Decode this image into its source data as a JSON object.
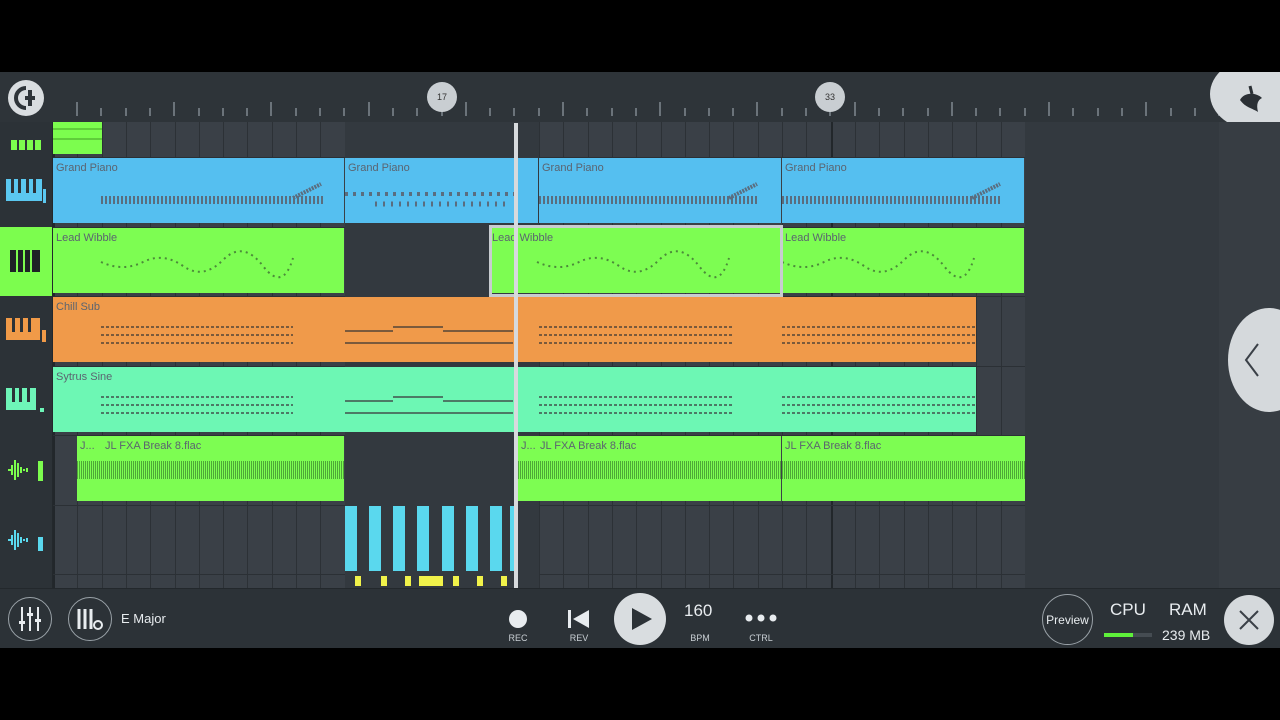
{
  "ruler": {
    "markers": [
      "17",
      "33"
    ]
  },
  "tracks": [
    {
      "icon": "step-sequencer-icon",
      "color": "#7cfd4e"
    },
    {
      "icon": "piano-keys-icon",
      "color": "#5bc8f0"
    },
    {
      "icon": "piano-keys-icon",
      "color": "#ffffff",
      "selected": true
    },
    {
      "icon": "piano-keys-icon",
      "color": "#f09a48"
    },
    {
      "icon": "piano-keys-icon",
      "color": "#6ef5b8"
    },
    {
      "icon": "waveform-icon",
      "color": "#7cfd4e"
    },
    {
      "icon": "waveform-icon",
      "color": "#5ad8ee"
    }
  ],
  "clips": {
    "grand_piano": "Grand Piano",
    "lead_wibble": "Lead Wibble",
    "chill_sub": "Chill Sub",
    "sytrus_sine": "Sytrus Sine",
    "break": "JL FXA Break 8.flac",
    "break_short_a": "J...",
    "break_short_b": "J..."
  },
  "colors": {
    "grand_piano": "#55bff0",
    "lead_wibble": "#7dfd52",
    "chill_sub": "#f09a4a",
    "sytrus_sine": "#6df7b4",
    "break": "#7dfd52",
    "hats": "#5ad8ee",
    "hats_notes": "#f1f24a"
  },
  "bottom": {
    "key": "E Major",
    "rec": "REC",
    "rev": "REV",
    "bpm_value": "160",
    "bpm": "BPM",
    "ctrl": "CTRL",
    "preview": "Preview",
    "cpu": "CPU",
    "ram": "RAM",
    "ram_value": "239 MB",
    "cpu_level": 0.6
  }
}
